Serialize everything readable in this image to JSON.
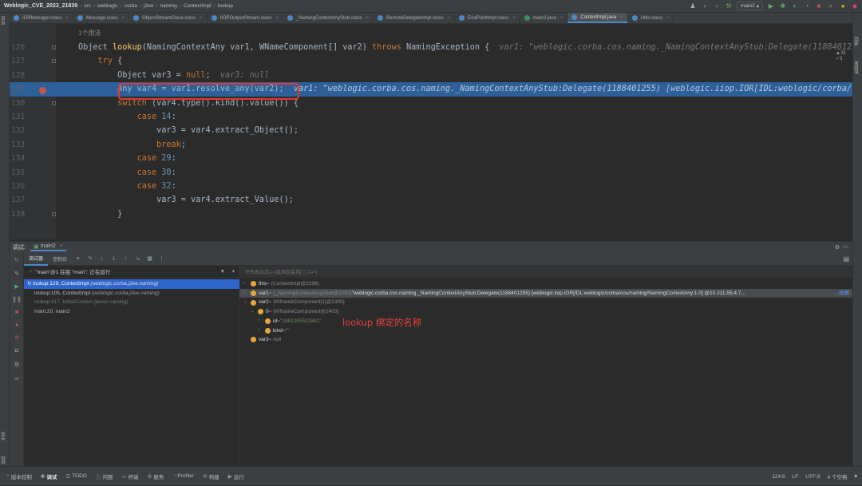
{
  "titlebar": {
    "project": "Weblogic_CVE_2023_21839",
    "breadcrumbs": [
      "src",
      "weblogic",
      "corba",
      "j2ee",
      "naming",
      "ContextImpl",
      "lookup"
    ],
    "run_config": "main2"
  },
  "tabs": [
    {
      "label": "IORManager.class",
      "color": "#4a88c7"
    },
    {
      "label": "Message.class",
      "color": "#4a88c7"
    },
    {
      "label": "ObjectStreamClass.class",
      "color": "#4a88c7"
    },
    {
      "label": "IIOPOutputStream.class",
      "color": "#4a88c7"
    },
    {
      "label": "_NamingContextAnyStub.class",
      "color": "#4a88c7"
    },
    {
      "label": "RemoteDelegateImpl.class",
      "color": "#4a88c7"
    },
    {
      "label": "EndPointImpl.class",
      "color": "#4a88c7"
    },
    {
      "label": "main2.java",
      "color": "#3d8a5e"
    },
    {
      "label": "ContextImpl.java",
      "color": "#4a88c7"
    },
    {
      "label": "Utils.class",
      "color": "#4a88c7"
    }
  ],
  "active_tab": 8,
  "editor": {
    "usages": "1个用法",
    "inspect": "▲33 ✓3",
    "lines": [
      {
        "n": "126",
        "text": "Object lookup(NamingContextAny var1, WNameComponent[] var2) throws NamingException {",
        "hint": "  var1: \"weblogic.corba.cos.naming._NamingContextAnyStub:Delegate(1188401255) [weblogic.iiop.IOR[IDL:weblogic/corba/cos/naming/NamingContextAny:1.0]"
      },
      {
        "n": "127",
        "text": "    try {",
        "hint": ""
      },
      {
        "n": "128",
        "text": "        Object var3 = null;",
        "hint": "  var3: null"
      },
      {
        "n": "129",
        "text": "        Any var4 = var1.resolve_any(var2);",
        "hint": "  var1: \"weblogic.corba.cos.naming._NamingContextAnyStub:Delegate(1188401255) [weblogic.iiop.IOR[IDL:weblogic/corba/cos/naming/NamingContextAny:1.0]"
      },
      {
        "n": "130",
        "text": "        switch (var4.type().kind().value()) {",
        "hint": ""
      },
      {
        "n": "131",
        "text": "            case 14:",
        "hint": ""
      },
      {
        "n": "132",
        "text": "                var3 = var4.extract_Object();",
        "hint": ""
      },
      {
        "n": "133",
        "text": "                break;",
        "hint": ""
      },
      {
        "n": "134",
        "text": "            case 29:",
        "hint": ""
      },
      {
        "n": "135",
        "text": "            case 30:",
        "hint": ""
      },
      {
        "n": "136",
        "text": "            case 32:",
        "hint": ""
      },
      {
        "n": "137",
        "text": "                var3 = var4.extract_Value();",
        "hint": ""
      },
      {
        "n": "138",
        "text": "        }",
        "hint": ""
      }
    ]
  },
  "debug": {
    "label": "调试:",
    "session": "main2",
    "tab_debugger": "调试器",
    "tab_console": "控制台",
    "thread": "\"main\"@1 在组 \"main\": 正在运行",
    "frames": [
      {
        "method": "lookup:129, ContextImpl",
        "pkg": "(weblogic.corba.j2ee.naming)",
        "state": "selected"
      },
      {
        "method": "lookup:105, ContextImpl",
        "pkg": "(weblogic.corba.j2ee.naming)",
        "state": "normal"
      },
      {
        "method": "lookup:417, InitialContext",
        "pkg": "(javax.naming)",
        "state": "library"
      },
      {
        "method": "main:20, main2",
        "pkg": "",
        "state": "normal"
      }
    ],
    "eval_placeholder": "评估表达式(↩)或添加监视(⇧⌘↩)",
    "variables": [
      {
        "indent": 0,
        "arrow": "›",
        "name": "this",
        "value": " = {ContextImpl@2296}",
        "selected": false
      },
      {
        "indent": 0,
        "arrow": "›",
        "name": "var1",
        "value": " = {_NamingContextAnyStub@2292} ",
        "str": "\"weblogic.corba.cos.naming._NamingContextAnyStub:Delegate(1188401255) [weblogic.iiop.IOR[IDL:weblogic/corba/cos/naming/NamingContextAny:1.0] @10.211.55.4:7...",
        "link": "...视图",
        "selected": true
      },
      {
        "indent": 0,
        "arrow": "⌄",
        "name": "var2",
        "value": " = {WNameComponent[1]@2395}",
        "selected": false
      },
      {
        "indent": 1,
        "arrow": "⌄",
        "name": "0",
        "value": " = {WNameComponent@2403}",
        "selected": false
      },
      {
        "indent": 2,
        "arrow": "›",
        "name": "id",
        "value": " = ",
        "str": "\"1681285511581\"",
        "selected": false
      },
      {
        "indent": 2,
        "arrow": "›",
        "name": "kind",
        "value": " = ",
        "str": "\"\"",
        "selected": false
      },
      {
        "indent": 0,
        "arrow": "",
        "name": "var3",
        "value": " = null",
        "selected": false
      }
    ],
    "annotation": "lookup 绑定的名称"
  },
  "statusbar": {
    "items": [
      "版本控制",
      "调试",
      "TODO",
      "问题",
      "终端",
      "服务",
      "Profiler",
      "构建",
      "运行"
    ],
    "active": 1,
    "position": "124:6",
    "line_sep": "LF",
    "encoding": "UTF-8",
    "indent": "4 个空格"
  }
}
